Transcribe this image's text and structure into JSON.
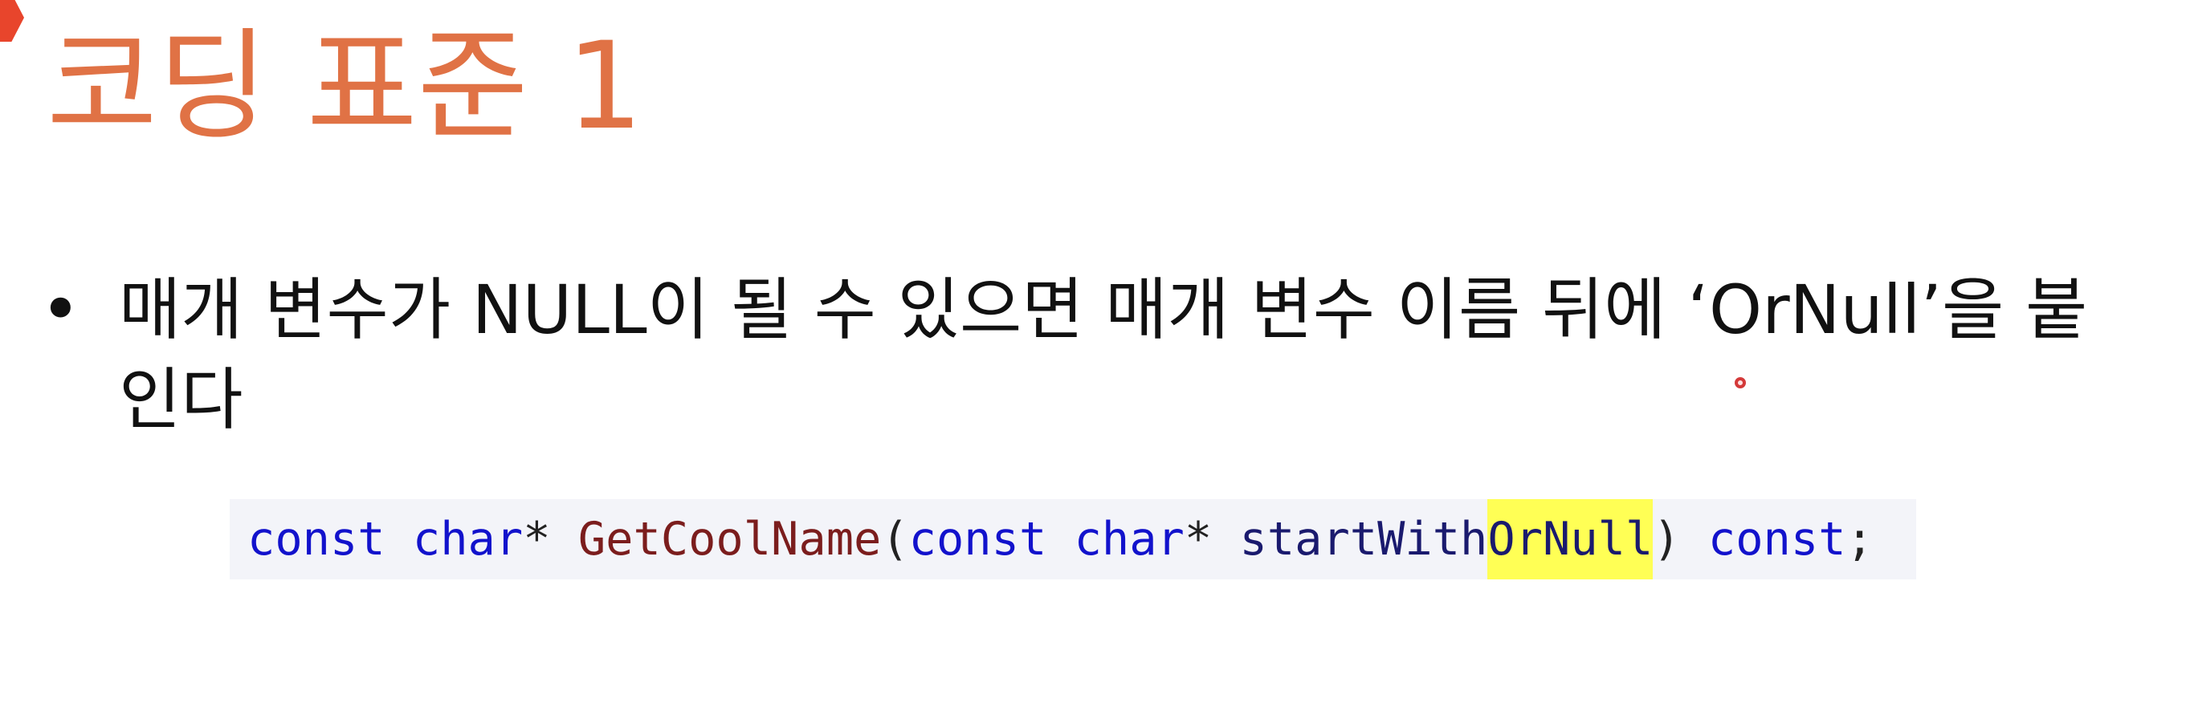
{
  "slide": {
    "title": "코딩 표준 1",
    "bullets": [
      {
        "marker": "•",
        "text": "매개 변수가 NULL이 될 수 있으면 매개 변수 이름 뒤에 ‘OrNull’을 붙인다"
      }
    ],
    "code": {
      "tokens": [
        {
          "text": "const",
          "role": "keyword"
        },
        {
          "text": " ",
          "role": "space"
        },
        {
          "text": "char",
          "role": "keyword"
        },
        {
          "text": "* ",
          "role": "operator"
        },
        {
          "text": "GetCoolName",
          "role": "function"
        },
        {
          "text": "(",
          "role": "operator"
        },
        {
          "text": "const",
          "role": "keyword"
        },
        {
          "text": " ",
          "role": "space"
        },
        {
          "text": "char",
          "role": "keyword"
        },
        {
          "text": "* ",
          "role": "operator"
        },
        {
          "text": "startWith",
          "role": "identifier"
        },
        {
          "text": "OrNull",
          "role": "highlighted-identifier"
        },
        {
          "text": ") ",
          "role": "operator"
        },
        {
          "text": "const",
          "role": "keyword"
        },
        {
          "text": ";",
          "role": "operator"
        }
      ]
    }
  },
  "colors": {
    "title": "#e07245",
    "corner_accent": "#e8452c",
    "code_background": "#f3f4f9",
    "keyword": "#1212cc",
    "function": "#7b1d1d",
    "highlight": "#ffff55",
    "pointer": "#d43a3a"
  },
  "icons": {
    "corner_mark": "red-arrow-tab-icon",
    "pointer": "laser-pointer-dot-icon"
  }
}
